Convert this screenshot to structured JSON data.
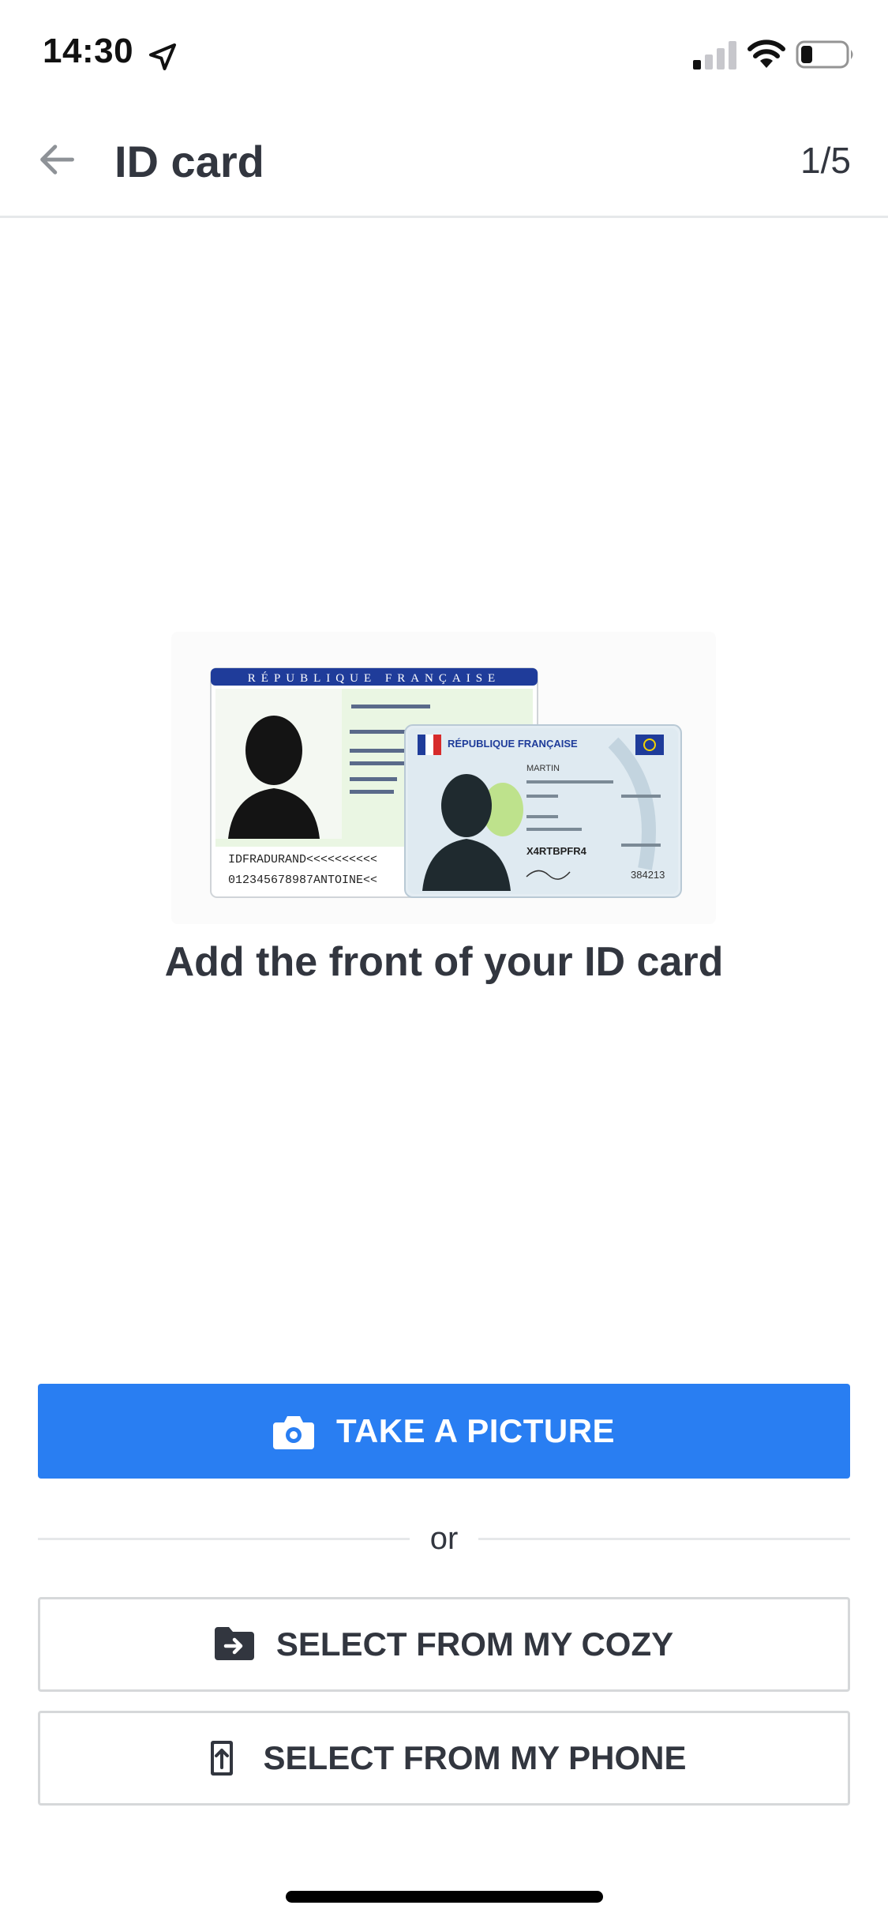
{
  "status_bar": {
    "time": "14:30",
    "icons": [
      "location-arrow-icon",
      "cellular-signal-icon",
      "wifi-icon",
      "battery-icon"
    ]
  },
  "header": {
    "back_icon": "arrow-left-icon",
    "title": "ID card",
    "step": "1/5"
  },
  "illustration": {
    "type": "id-card-image",
    "old_card_header": "RÉPUBLIQUE FRANÇAISE",
    "new_card_header": "RÉPUBLIQUE FRANÇAISE",
    "old_card_mrz_1": "IDFRADURAND<<<<<<<<<<",
    "old_card_mrz_2": "012345678987ANTOINE<<",
    "new_card_name": "MARTIN",
    "new_card_number": "X4RTBPFR4",
    "new_card_code": "384213"
  },
  "instruction": "Add the front of your ID card",
  "actions": {
    "take_picture": {
      "label": "TAKE A PICTURE",
      "icon": "camera-icon"
    },
    "divider_label": "or",
    "select_cozy": {
      "label": "SELECT FROM MY COZY",
      "icon": "folder-move-icon"
    },
    "select_phone": {
      "label": "SELECT FROM MY PHONE",
      "icon": "phone-upload-icon"
    }
  },
  "colors": {
    "primary": "#297ef2",
    "text": "#32363f",
    "border": "#d6d8da",
    "divider": "#e6e8ea"
  }
}
